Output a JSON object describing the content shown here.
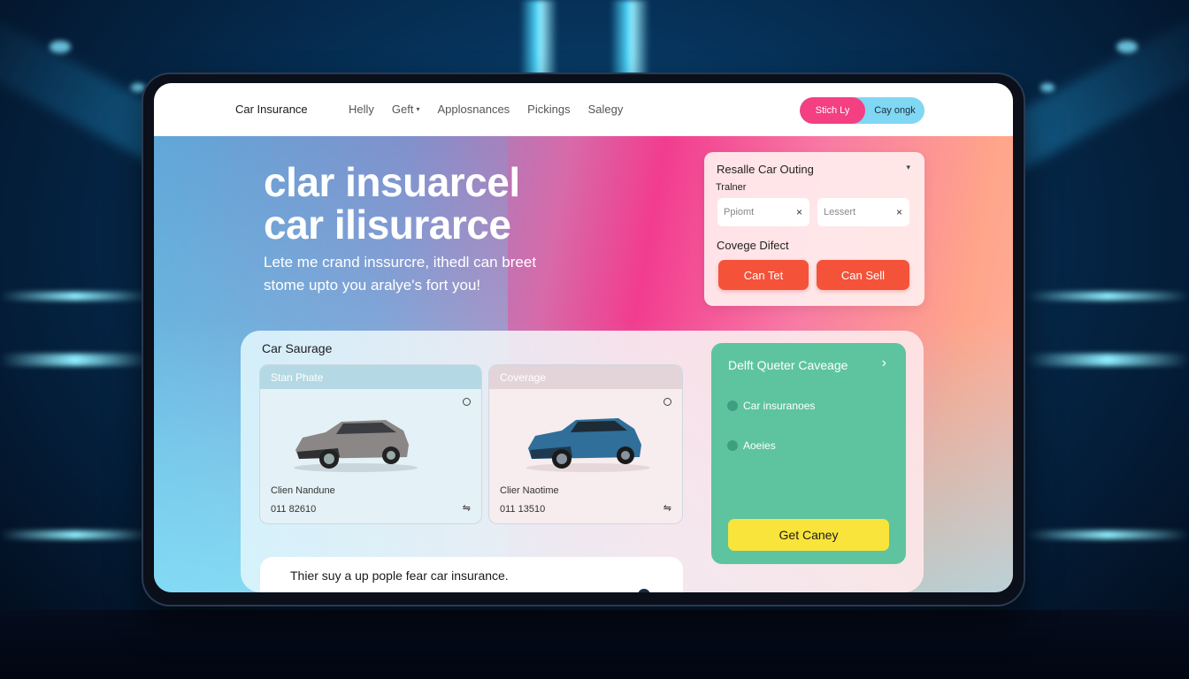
{
  "nav": {
    "brand": "Car Insurance",
    "links": [
      {
        "label": "Helly",
        "has_dropdown": false
      },
      {
        "label": "Geft",
        "has_dropdown": true
      },
      {
        "label": "Applosnances",
        "has_dropdown": false
      },
      {
        "label": "Pickings",
        "has_dropdown": false
      },
      {
        "label": "Salegy",
        "has_dropdown": false
      }
    ],
    "pill": {
      "primary": "Stich Ly",
      "secondary": "Cay ongk"
    },
    "caret_icon": "▾"
  },
  "hero": {
    "title_line1": "clar insuarcel",
    "title_line2": "car ilisurarce",
    "subtitle": "Lete me crand inssurcre, ithedl can breet stome upto you aralye's fort you!"
  },
  "resale": {
    "title": "Resalle Car Outing",
    "caret_icon": "▾",
    "label": "Tralner",
    "inputs": [
      {
        "value": "Ppiomt",
        "clear_icon": "×"
      },
      {
        "value": "Lessert",
        "clear_icon": "×"
      }
    ],
    "coverage_label": "Covege Difect",
    "buttons": [
      "Can Tet",
      "Can Sell"
    ]
  },
  "lower": {
    "title": "Car Saurage",
    "cards": [
      {
        "header": "Stan Phate",
        "name": "Clien Nandune",
        "number": "011 82610",
        "link_icon": "⇋",
        "car_color": "#8a8786"
      },
      {
        "header": "Coverage",
        "name": "Clier Naotime",
        "number": "011 13510",
        "link_icon": "⇋",
        "car_color": "#2f6f9a"
      }
    ]
  },
  "green": {
    "title": "Delft Queter Caveage",
    "chevron_icon": "›",
    "items": [
      "Car insuranoes",
      "Aoeies"
    ],
    "button": "Get Caney"
  },
  "quote": {
    "text": "Thier suy a up pople fear car insurance."
  },
  "colors": {
    "accent_pink": "#f43f82",
    "accent_cyan": "#7fd7f3",
    "button_red": "#f4533a",
    "panel_green": "#5ec4a0",
    "button_yellow": "#f9e43b"
  }
}
